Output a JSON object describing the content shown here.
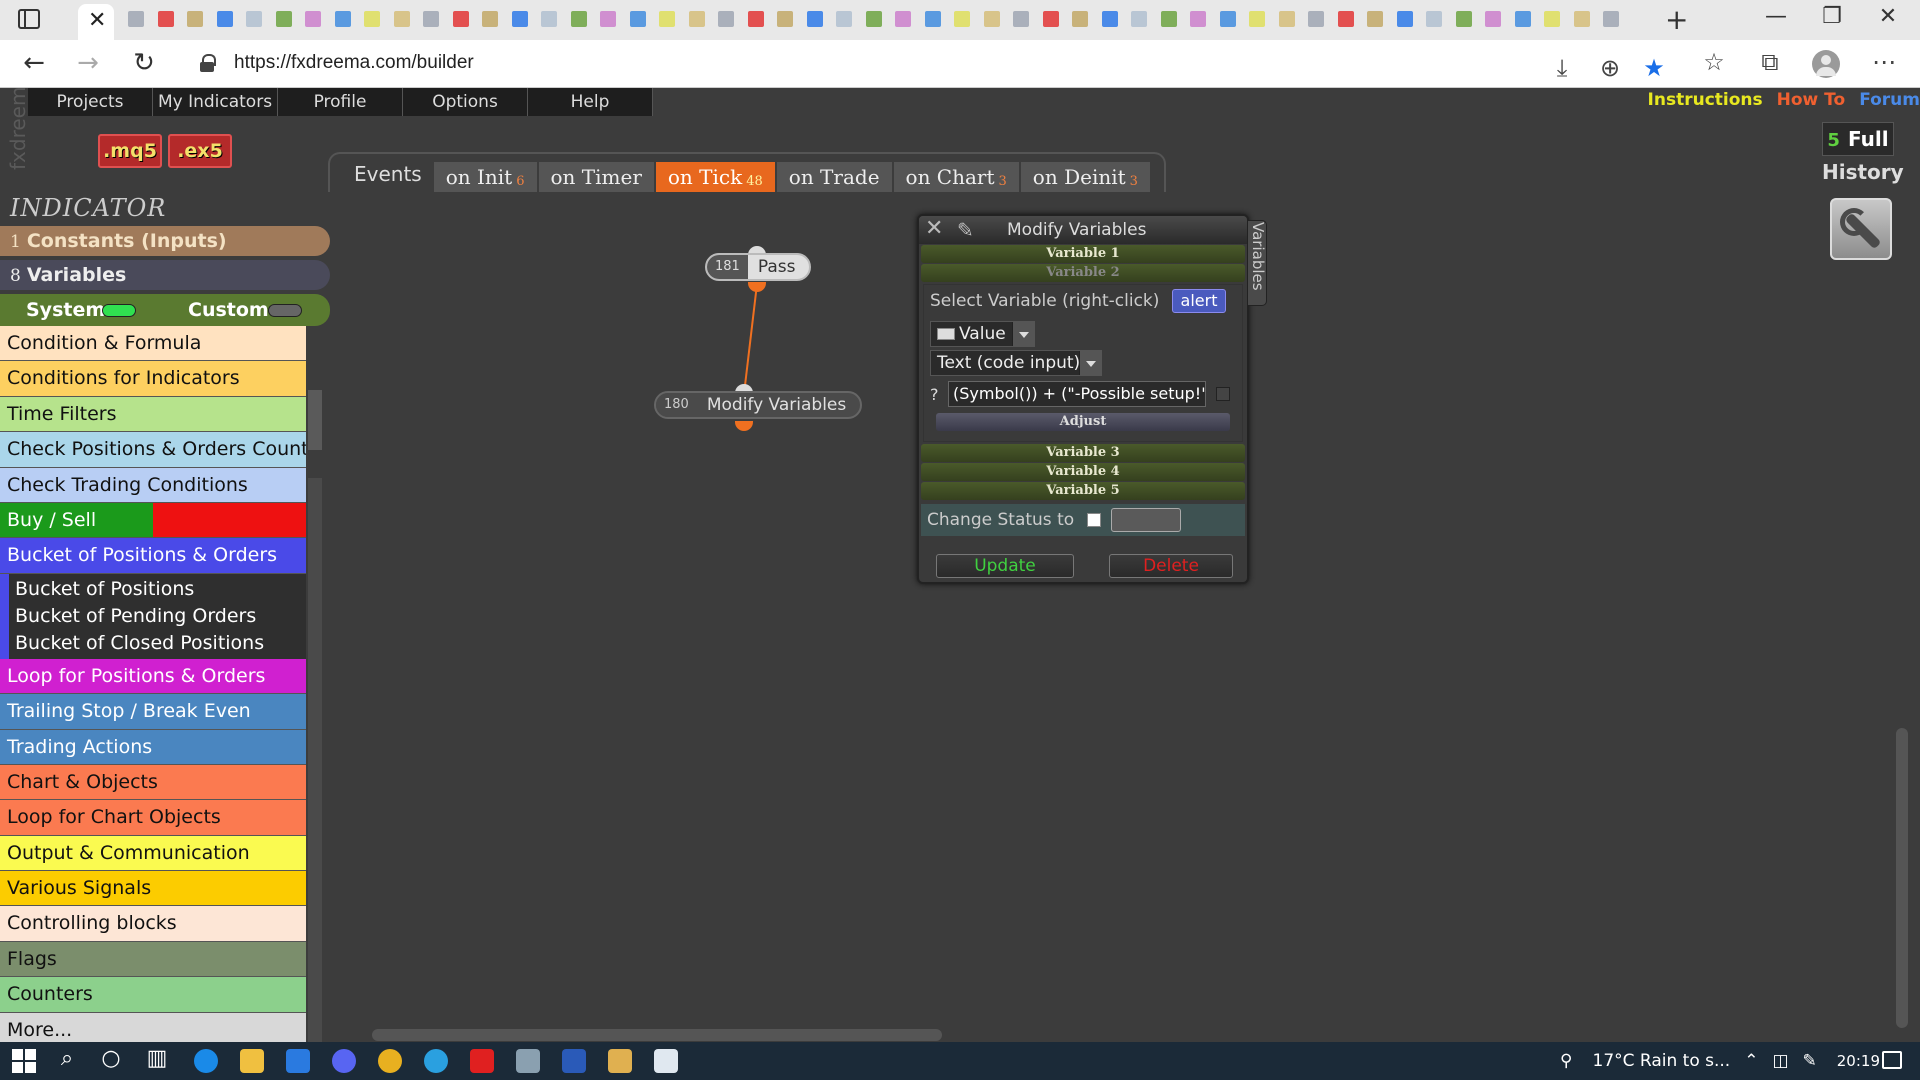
{
  "browser": {
    "url": "https://fxdreema.com/builder",
    "tab_favicon_colors": [
      "#d8c48a",
      "#aab0bb",
      "#e35050",
      "#c8b27a",
      "#4a8ae8",
      "#b9c6d4",
      "#7fae5a",
      "#d08fd0",
      "#5a9ae0",
      "#e0e070"
    ],
    "tab_count": 52
  },
  "app": {
    "brand_vertical": "fxdreema",
    "menu": [
      "Projects",
      "My Indicators",
      "Profile",
      "Options",
      "Help"
    ],
    "toplinks": [
      "Instructions",
      "How To",
      "Forum"
    ],
    "file_buttons": [
      ".mq5",
      ".ex5"
    ],
    "full": {
      "count": "5",
      "label": "Full"
    },
    "history": "History",
    "events_label": "Events",
    "events": [
      {
        "label": "on Init",
        "count": "6"
      },
      {
        "label": "on Timer",
        "count": ""
      },
      {
        "label": "on Tick",
        "count": "48",
        "active": true
      },
      {
        "label": "on Trade",
        "count": ""
      },
      {
        "label": "on Chart",
        "count": "3"
      },
      {
        "label": "on Deinit",
        "count": "3"
      }
    ],
    "colors": {
      "active_event": "#e8681e",
      "accent_green": "#30e050"
    }
  },
  "sidebar": {
    "title": "INDICATOR",
    "constants": {
      "count": "1",
      "label": "Constants (Inputs)"
    },
    "variables": {
      "count": "8",
      "label": "Variables"
    },
    "system_label": "System",
    "custom_label": "Custom",
    "categories": [
      {
        "label": "Condition & Formula",
        "color": "#ffe2c0"
      },
      {
        "label": "Conditions for Indicators",
        "color": "#fdd060"
      },
      {
        "label": "Time Filters",
        "color": "#b6e38c"
      },
      {
        "label": "Check Positions & Orders Count",
        "color": "#aad6ea"
      },
      {
        "label": "Check Trading Conditions",
        "color": "#b8cef4"
      },
      {
        "label": "Buy / Sell",
        "color": "buysell"
      },
      {
        "label": "Bucket of Positions & Orders",
        "color": "#4a4ae8"
      },
      {
        "label": "Loop for Positions & Orders",
        "color": "#d020d0"
      },
      {
        "label": "Trailing Stop / Break Even",
        "color": "#4a86c0"
      },
      {
        "label": "Trading Actions",
        "color": "#4a86c0"
      },
      {
        "label": "Chart & Objects",
        "color": "#fb7a50"
      },
      {
        "label": "Loop for Chart Objects",
        "color": "#fb7a50"
      },
      {
        "label": "Output & Communication",
        "color": "#fafa50"
      },
      {
        "label": "Various Signals",
        "color": "#fccc00"
      },
      {
        "label": "Controlling blocks",
        "color": "#fde6d6"
      },
      {
        "label": "Flags",
        "color": "#7b8e6c"
      },
      {
        "label": "Counters",
        "color": "#8cd08c"
      },
      {
        "label": "More...",
        "color": "#d8d8d8"
      }
    ],
    "bucket_subs": [
      "Bucket of Positions",
      "Bucket of Pending Orders",
      "Bucket of Closed Positions"
    ]
  },
  "canvas": {
    "nodes": [
      {
        "id": "181",
        "label": "Pass"
      },
      {
        "id": "180",
        "label": "Modify Variables"
      }
    ]
  },
  "dialog": {
    "title": "Modify Variables",
    "side_tab": "Variables",
    "var1": "Variable 1",
    "var2": "Variable 2",
    "select_label": "Select Variable (right-click)",
    "selected_var": "alert",
    "value_type": "Value",
    "input_mode": "Text (code input)",
    "code_prefix": "?",
    "code_value": "(Symbol()) + (\"-Possible setup!\");",
    "adjust": "Adjust",
    "var3": "Variable 3",
    "var4": "Variable 4",
    "var5": "Variable 5",
    "status_label": "Change Status to",
    "update": "Update",
    "delete": "Delete"
  },
  "taskbar": {
    "weather": "17°C  Rain to s...",
    "clock": "20:19"
  }
}
